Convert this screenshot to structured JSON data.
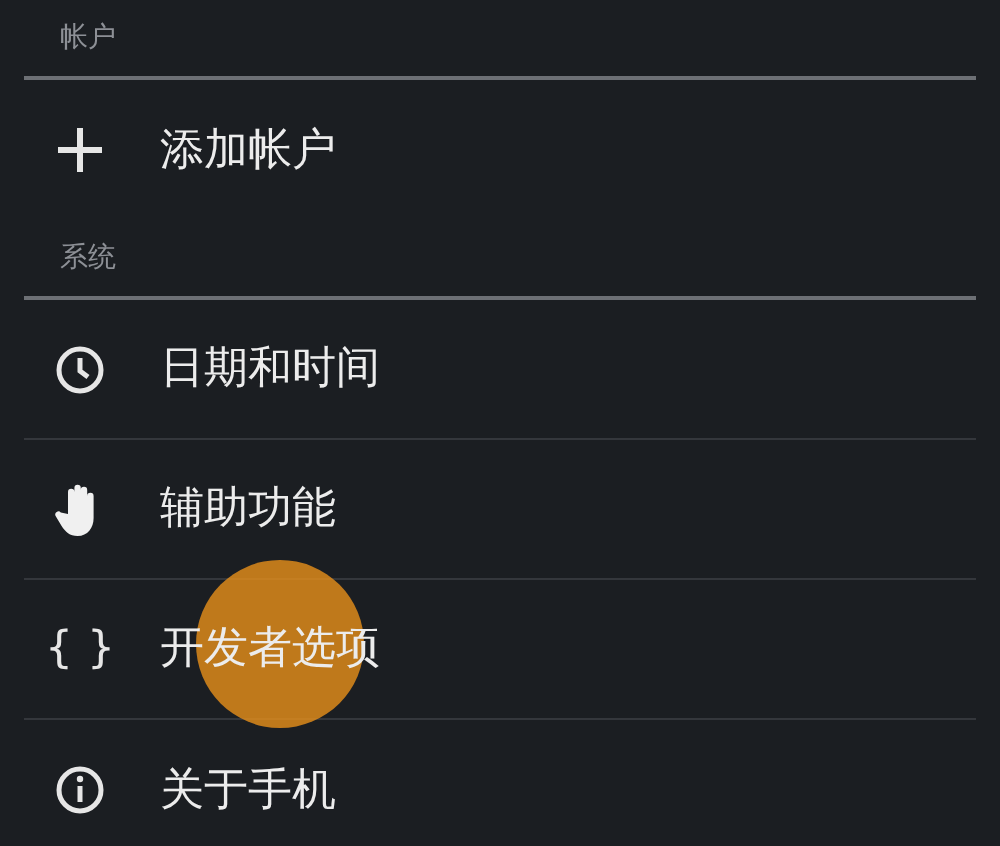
{
  "sections": [
    {
      "header": "帐户",
      "items": [
        {
          "kind": "plus",
          "label": "添加帐户",
          "touched": false
        }
      ]
    },
    {
      "header": "系统",
      "items": [
        {
          "kind": "clock",
          "label": "日期和时间",
          "touched": false
        },
        {
          "kind": "hand",
          "label": "辅助功能",
          "touched": false
        },
        {
          "kind": "braces",
          "icon_text": "{ }",
          "label": "开发者选项",
          "touched": true
        },
        {
          "kind": "info",
          "label": "关于手机",
          "touched": false
        }
      ]
    }
  ]
}
